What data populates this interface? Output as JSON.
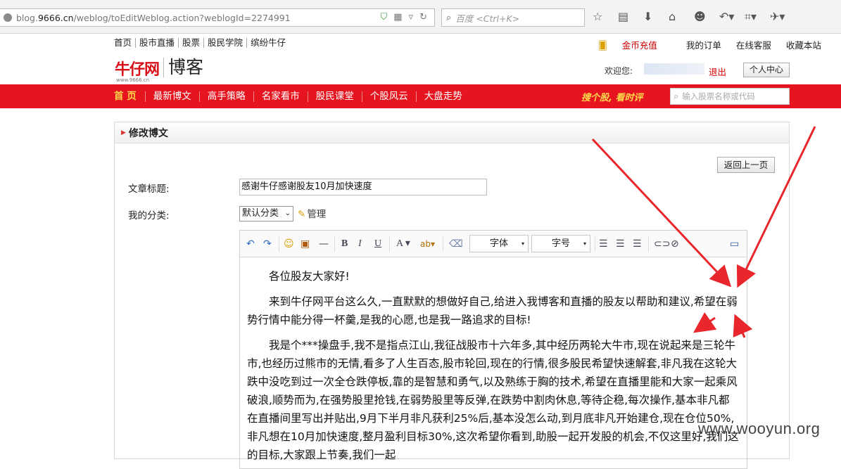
{
  "browser": {
    "url_prefix": "blog.",
    "url_domain": "9666.cn",
    "url_rest": "/weblog/toEditWeblog.action?weblogId=2274991",
    "search_placeholder": "百度 <Ctrl+K>",
    "toolbar_icons": [
      "bookmark-star-icon",
      "reading-list-icon",
      "download-icon",
      "home-icon",
      "chat-icon",
      "back-undo-icon",
      "screenshot-crop-icon",
      "extension-icon"
    ]
  },
  "site": {
    "top_nav": [
      "首页",
      "股市直播",
      "股票",
      "股民学院",
      "缤纷牛仔"
    ],
    "top_links": {
      "coins": "金币充值",
      "orders": "我的订单",
      "service": "在线客服",
      "favorite": "收藏本站"
    },
    "logo_text": "牛仔网",
    "logo_sub": "www.9666.cn",
    "blog_word": "博客",
    "welcome": "欢迎您:",
    "logout": "退出",
    "user_center": "个人中心",
    "main_nav": [
      "首 页",
      "最新博文",
      "高手策略",
      "名家看市",
      "股民课堂",
      "个股风云",
      "大盘走势"
    ],
    "slogan": "搜个股, 看时评",
    "stock_search_placeholder": "输入股票名称或代码",
    "accent": "#e5141e"
  },
  "form": {
    "panel_title": "修改博文",
    "back_button": "返回上一页",
    "title_label": "文章标题:",
    "title_value": "感谢牛仔感谢股友10月加快速度",
    "category_label": "我的分类:",
    "category_value": "默认分类",
    "manage_link": "管理",
    "font_select": "字体",
    "size_select": "字号",
    "paragraphs": [
      "各位股友大家好!",
      "来到牛仔网平台这么久,一直默默的想做好自己,给进入我博客和直播的股友以帮助和建议,希望在弱势行情中能分得一杯羹,是我的心愿,也是我一路追求的目标!",
      "我是个***操盘手,我不是指点江山,我征战股市十六年多,其中经历两轮大牛市,现在说起来是三轮牛市,也经历过熊市的无情,看多了人生百态,股市轮回,现在的行情,很多股民希望快速解套,非凡我在这轮大跌中没吃到过一次全仓跌停板,靠的是智慧和勇气,以及熟练于胸的技术,希望在直播里能和大家一起乘风破浪,顺势而为,在强势股里抢钱,在弱势股里等反弹,在跌势中割肉休息,等待企稳,每次操作,基本非凡都在直播间里写出并贴出,9月下半月非凡获利25%后,基本没怎么动,到月底非凡开始建仓,现在仓位50%,非凡想在10月加快速度,整月盈利目标30%,这次希望你看到,助股一起开发股的机会,不仅这里好,我们这的目标,大家跟上节奏,我们一起"
    ]
  },
  "watermark": "www.wooyun.org"
}
